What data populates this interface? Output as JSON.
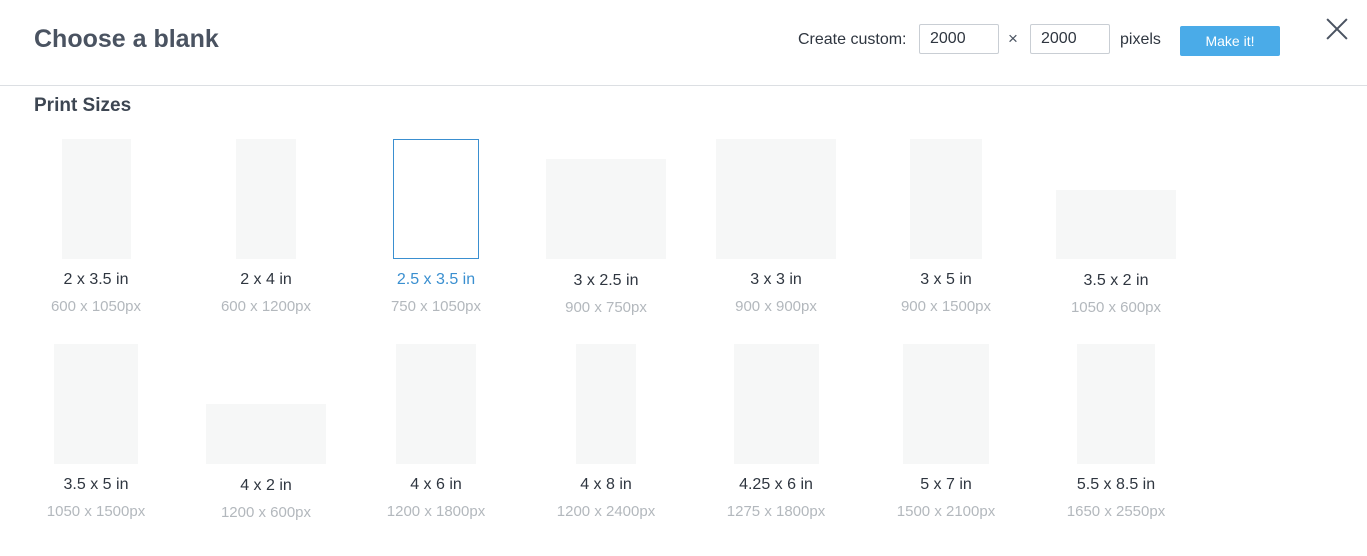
{
  "header": {
    "title": "Choose a blank",
    "custom_label": "Create custom:",
    "width_value": "2000",
    "height_value": "2000",
    "times_symbol": "×",
    "pixels_label": "pixels",
    "make_button": "Make it!",
    "close_icon": "close-icon"
  },
  "section": {
    "title": "Print Sizes"
  },
  "sizes": [
    {
      "label": "2 x 3.5 in",
      "px": "600 x 1050px"
    },
    {
      "label": "2 x 4 in",
      "px": "600 x 1200px"
    },
    {
      "label": "2.5 x 3.5 in",
      "px": "750 x 1050px",
      "selected": true
    },
    {
      "label": "3 x 2.5 in",
      "px": "900 x 750px"
    },
    {
      "label": "3 x 3 in",
      "px": "900 x 900px"
    },
    {
      "label": "3 x 5 in",
      "px": "900 x 1500px"
    },
    {
      "label": "3.5 x 2 in",
      "px": "1050 x 600px"
    },
    {
      "label": "3.5 x 5 in",
      "px": "1050 x 1500px"
    },
    {
      "label": "4 x 2 in",
      "px": "1200 x 600px"
    },
    {
      "label": "4 x 6 in",
      "px": "1200 x 1800px"
    },
    {
      "label": "4 x 8 in",
      "px": "1200 x 2400px"
    },
    {
      "label": "4.25 x 6 in",
      "px": "1275 x 1800px"
    },
    {
      "label": "5 x 7 in",
      "px": "1500 x 2100px"
    },
    {
      "label": "5.5 x 8.5 in",
      "px": "1650 x 2550px"
    }
  ],
  "colors": {
    "accent": "#4aabe8",
    "selected": "#3a8fd0",
    "thumb": "#f6f7f7"
  }
}
